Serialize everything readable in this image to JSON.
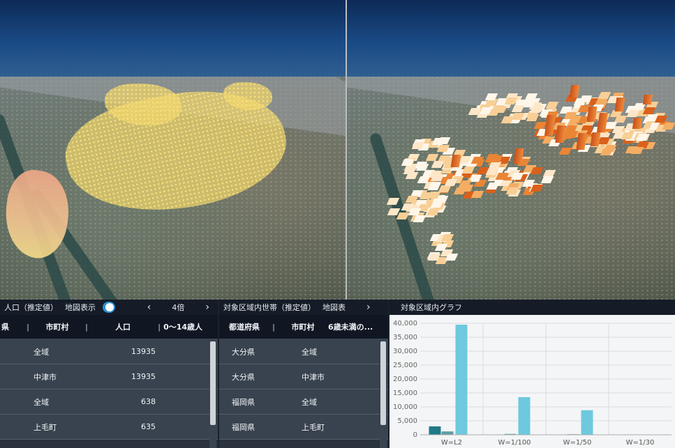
{
  "left_panel": {
    "title": "人口（推定値）",
    "map_toggle_label": "地図表示",
    "zoom_label": "4倍",
    "prev": "‹",
    "next": "›",
    "columns": [
      "県",
      "市町村",
      "人口",
      "0〜14歳人"
    ],
    "rows": [
      {
        "municipality": "全域",
        "population": "13935"
      },
      {
        "municipality": "中津市",
        "population": "13935"
      },
      {
        "municipality": "全域",
        "population": "638"
      },
      {
        "municipality": "上毛町",
        "population": "635"
      }
    ]
  },
  "middle_panel": {
    "title": "対象区域内世帯（推定値）",
    "map_label": "地図表",
    "next": "›",
    "columns": [
      "都道府県",
      "市町村",
      "6歳未満の..."
    ],
    "rows": [
      {
        "prefecture": "大分県",
        "municipality": "全域"
      },
      {
        "prefecture": "大分県",
        "municipality": "中津市"
      },
      {
        "prefecture": "福岡県",
        "municipality": "全域"
      },
      {
        "prefecture": "福岡県",
        "municipality": "上毛町"
      }
    ]
  },
  "chart_panel": {
    "title": "対象区域内グラフ"
  },
  "chart_data": {
    "type": "bar",
    "categories": [
      "W=L2",
      "W=1/100",
      "W=1/50",
      "W=1/30"
    ],
    "series": [
      {
        "color": "#1f7a86",
        "values": [
          3000,
          0,
          0,
          0
        ]
      },
      {
        "color": "#5e9ea6",
        "values": [
          1200,
          300,
          200,
          0
        ]
      },
      {
        "color": "#6ec9de",
        "values": [
          39500,
          13500,
          8800,
          0
        ]
      }
    ],
    "ylim": [
      0,
      40000
    ],
    "yticks": [
      "0",
      "5,000",
      "10,000",
      "15,000",
      "20,000",
      "25,000",
      "30,000",
      "35,000",
      "40,000"
    ],
    "grid": true
  }
}
